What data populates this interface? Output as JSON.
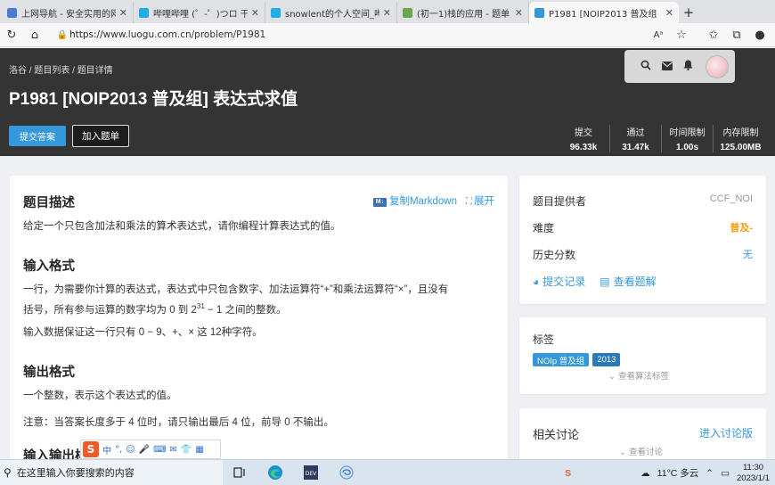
{
  "browser": {
    "tabs": [
      {
        "label": "上网导航 - 安全实用的网",
        "icon_color": "#4a7bd0",
        "active": false
      },
      {
        "label": "哔哩哔哩 (゜-゜)つロ 干杯",
        "icon_color": "#23ade5",
        "active": false
      },
      {
        "label": "snowlent的个人空间_哔哩",
        "icon_color": "#23ade5",
        "active": false
      },
      {
        "label": "(初一1)栈的应用 - 题单 -",
        "icon_color": "#6aa84f",
        "active": false
      },
      {
        "label": "P1981 [NOIP2013 普及组",
        "icon_color": "#3498db",
        "active": true
      }
    ],
    "new_tab_icon": "plus-icon",
    "url_prefix": "https://",
    "url_rest": "www.luogu.com.cn/problem/P1981"
  },
  "header": {
    "breadcrumb": [
      "洛谷",
      "题目列表",
      "题目详情"
    ],
    "breadcrumb_sep": " / ",
    "title": "P1981 [NOIP2013 普及组] 表达式求值",
    "submit_label": "提交答案",
    "add_label": "加入题单",
    "stats": [
      {
        "label": "提交",
        "value": "96.33k"
      },
      {
        "label": "通过",
        "value": "31.47k"
      },
      {
        "label": "时间限制",
        "value": "1.00s"
      },
      {
        "label": "内存限制",
        "value": "125.00MB"
      }
    ]
  },
  "problem": {
    "desc_heading": "题目描述",
    "copy_markdown": "复制Markdown",
    "md_badge": "M↓",
    "expand": "展开",
    "desc_text": "给定一个只包含加法和乘法的算术表达式，请你编程计算表达式的值。",
    "input_heading": "输入格式",
    "input_text_1": "一行，为需要你计算的表达式，表达式中只包含数字、加法运算符“+”和乘法运算符“×”，且没有",
    "input_text_2": "括号，所有参与运算的数字均为 0 到 2",
    "input_text_2_sup": "31",
    "input_text_2_end": " − 1 之间的整数。",
    "input_text_3": "输入数据保证这一行只有 0 − 9、+、× 这 12种字符。",
    "output_heading": "输出格式",
    "output_text_1": "一个整数，表示这个表达式的值。",
    "output_text_2": "注意：当答案长度多于 4 位时，请只输出最后 4 位，前导 0 不输出。",
    "sample_heading": "输入输出样"
  },
  "sidebar": {
    "provider_label": "题目提供者",
    "provider_value": "CCF_NOI",
    "difficulty_label": "难度",
    "difficulty_value": "普及-",
    "difficulty_color": "#f39c11",
    "history_label": "历史分数",
    "history_value": "无",
    "records_link": "提交记录",
    "solutions_link": "查看题解",
    "tags_heading": "标签",
    "tags": [
      {
        "label": "NOIp 普及组",
        "color": "#3498db"
      },
      {
        "label": "2013",
        "color": "#2a7ab8"
      }
    ],
    "show_algo_tags": "查看算法标签",
    "discuss_heading": "相关讨论",
    "discuss_link": "进入讨论版",
    "view_discuss": "查看讨论"
  },
  "ime": {
    "logo": "S",
    "items": [
      "中",
      "°,",
      "☺",
      "🎤",
      "⌨",
      "✉",
      "👕",
      "▦"
    ]
  },
  "taskbar": {
    "search_placeholder": "在这里输入你要搜索的内容",
    "weather": "11°C 多云",
    "time": "11:30",
    "date": "2023/1/1"
  }
}
